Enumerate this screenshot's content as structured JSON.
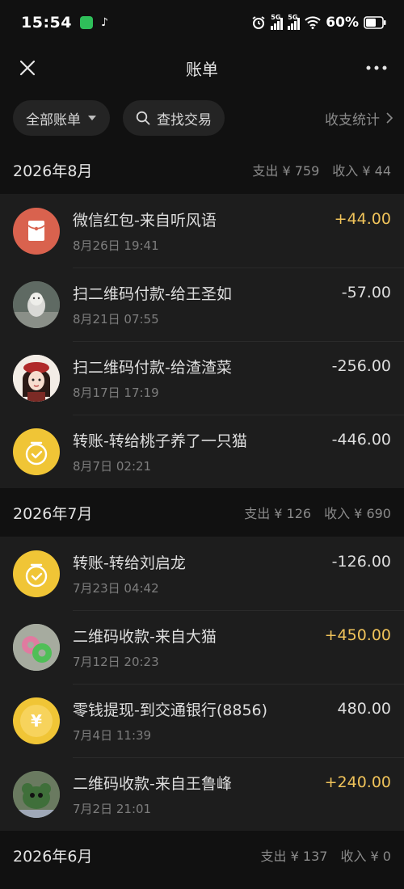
{
  "status_bar": {
    "time": "15:54",
    "signal1": "5G",
    "signal2": "5G",
    "battery": "60%"
  },
  "nav": {
    "title": "账单"
  },
  "filters": {
    "all_bills": "全部账单",
    "search": "查找交易",
    "stats": "收支统计"
  },
  "months": [
    {
      "title": "2026年8月",
      "expense": "支出 ¥ 759",
      "income": "收入 ¥ 44",
      "transactions": [
        {
          "title": "微信红包-来自听风语",
          "date": "8月26日 19:41",
          "amount": "+44.00",
          "type": "income",
          "icon": "red-packet-icon"
        },
        {
          "title": "扫二维码付款-给王圣如",
          "date": "8月21日 07:55",
          "amount": "-57.00",
          "type": "expense",
          "icon": "user-avatar"
        },
        {
          "title": "扫二维码付款-给渣渣菜",
          "date": "8月17日 17:19",
          "amount": "-256.00",
          "type": "expense",
          "icon": "user-avatar"
        },
        {
          "title": "转账-转给桃子养了一只猫",
          "date": "8月7日 02:21",
          "amount": "-446.00",
          "type": "expense",
          "icon": "transfer-icon"
        }
      ]
    },
    {
      "title": "2026年7月",
      "expense": "支出 ¥ 126",
      "income": "收入 ¥ 690",
      "transactions": [
        {
          "title": "转账-转给刘启龙",
          "date": "7月23日 04:42",
          "amount": "-126.00",
          "type": "expense",
          "icon": "transfer-icon"
        },
        {
          "title": "二维码收款-来自大猫",
          "date": "7月12日 20:23",
          "amount": "+450.00",
          "type": "income",
          "icon": "user-avatar"
        },
        {
          "title": "零钱提现-到交通银行(8856)",
          "date": "7月4日 11:39",
          "amount": "480.00",
          "type": "neutral",
          "icon": "yuan-coin-icon"
        },
        {
          "title": "二维码收款-来自王鲁峰",
          "date": "7月2日 21:01",
          "amount": "+240.00",
          "type": "income",
          "icon": "user-avatar"
        }
      ]
    },
    {
      "title": "2026年6月",
      "expense": "支出 ¥ 137",
      "income": "收入 ¥ 0",
      "transactions": []
    }
  ],
  "colors": {
    "background": "#111111",
    "row_background": "#1d1d1d",
    "income": "#f0c35a",
    "red_packet": "#d9624e",
    "transfer": "#f0c536"
  }
}
